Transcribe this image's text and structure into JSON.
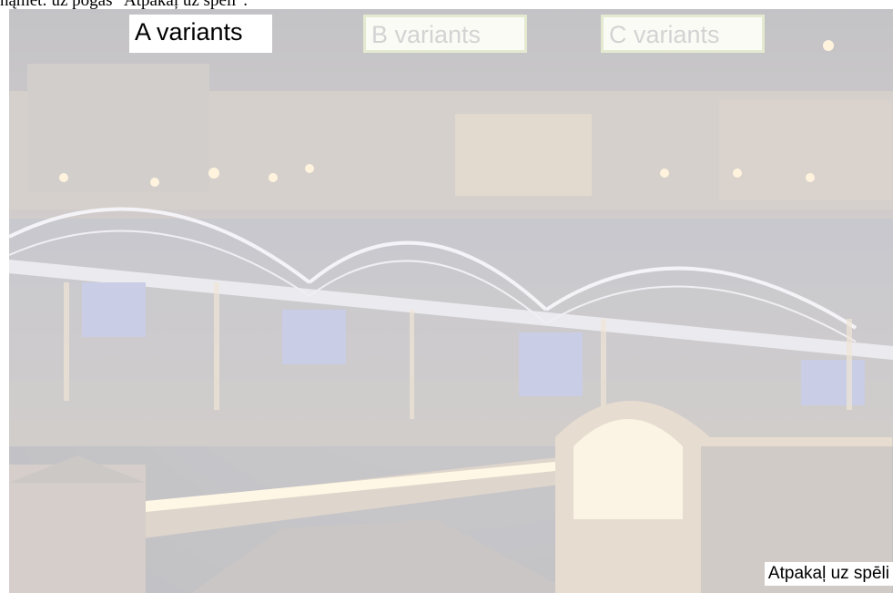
{
  "top_caption": "nąmet: uz pogas \"Atpakaļ uz spēli\".",
  "buttons": {
    "a_label": "A variants",
    "b_label": "B variants",
    "c_label": "C variants"
  },
  "back_link_label": "Atpakaļ uz spēli",
  "colors": {
    "active_button_bg": "#ffffff",
    "inactive_button_text": "#d3d3d3",
    "inactive_button_border": "#e4ead0"
  }
}
